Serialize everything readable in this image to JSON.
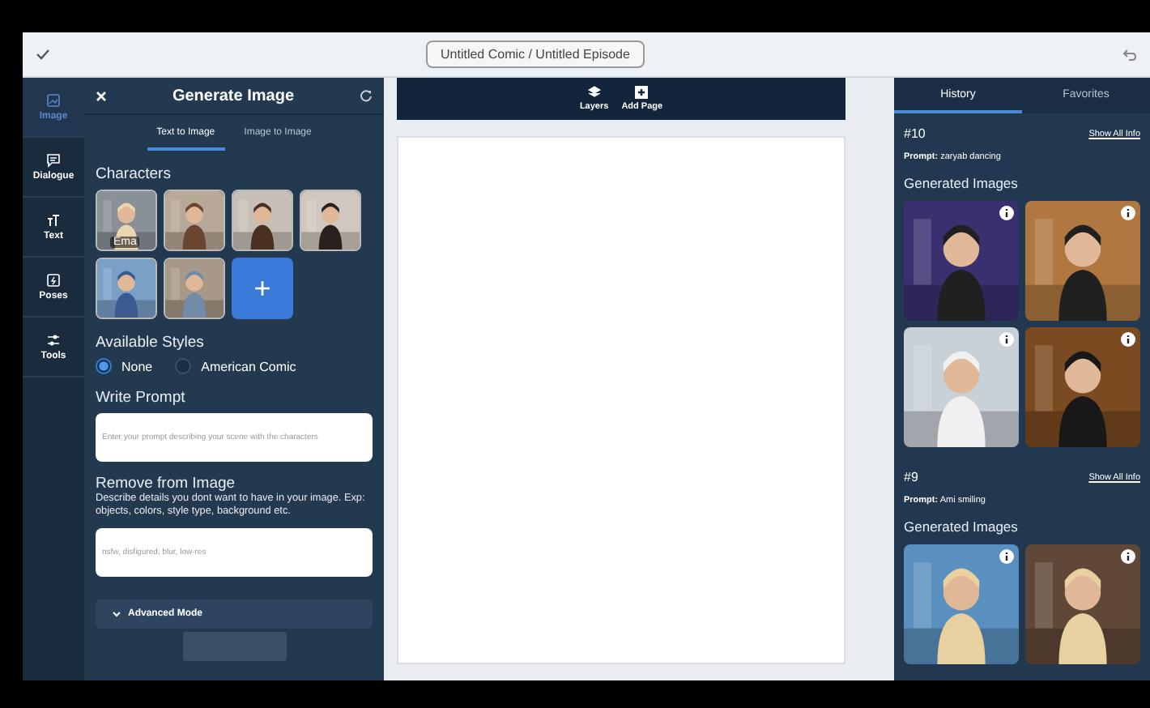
{
  "top_bar": {
    "title": "Untitled Comic / Untitled Episode"
  },
  "rail": [
    {
      "label": "Image",
      "selected": true
    },
    {
      "label": "Dialogue",
      "selected": false
    },
    {
      "label": "Text",
      "selected": false
    },
    {
      "label": "Poses",
      "selected": false
    },
    {
      "label": "Tools",
      "selected": false
    }
  ],
  "panel": {
    "title": "Generate Image",
    "tabs": [
      {
        "label": "Text to Image",
        "selected": true
      },
      {
        "label": "Image to Image",
        "selected": false
      }
    ],
    "characters_heading": "Characters",
    "characters": [
      {
        "kind": "picture",
        "caption": "Ema"
      },
      {
        "kind": "picture"
      },
      {
        "kind": "picture"
      },
      {
        "kind": "picture"
      },
      {
        "kind": "picture"
      },
      {
        "kind": "picture"
      },
      {
        "kind": "add",
        "label": "+"
      }
    ],
    "styles_heading": "Available Styles",
    "styles": [
      {
        "label": "None",
        "selected": true
      },
      {
        "label": "American Comic",
        "selected": false
      }
    ],
    "prompt_heading": "Write Prompt",
    "prompt": {
      "placeholder": "Enter your prompt describing your scene with the characters"
    },
    "remove_heading": "Remove from Image",
    "remove_help": "Describe details you dont want to have in your image. Exp: objects, colors, style type, background etc.",
    "remove": {
      "placeholder": "nsfw, disfigured, blur, low-res"
    },
    "advanced": {
      "label": "Advanced Mode",
      "expanded": false
    }
  },
  "canvas_toolbar": [
    {
      "label": "Layers"
    },
    {
      "label": "Add Page"
    }
  ],
  "history": {
    "tabs": [
      {
        "label": "History",
        "selected": true
      },
      {
        "label": "Favorites",
        "selected": false
      }
    ],
    "entries": [
      {
        "number": "#10",
        "link": "Show All Info",
        "prompt_label": "Prompt:",
        "prompt": "zaryab dancing",
        "heading": "Generated Images",
        "images": [
          {
            "kind": "picture"
          },
          {
            "kind": "picture"
          },
          {
            "kind": "picture"
          },
          {
            "kind": "picture"
          }
        ]
      },
      {
        "number": "#9",
        "link": "Show All Info",
        "prompt_label": "Prompt:",
        "prompt": "Ami smiling",
        "heading": "Generated Images",
        "images": [
          {
            "kind": "picture"
          },
          {
            "kind": "picture"
          }
        ]
      }
    ]
  }
}
